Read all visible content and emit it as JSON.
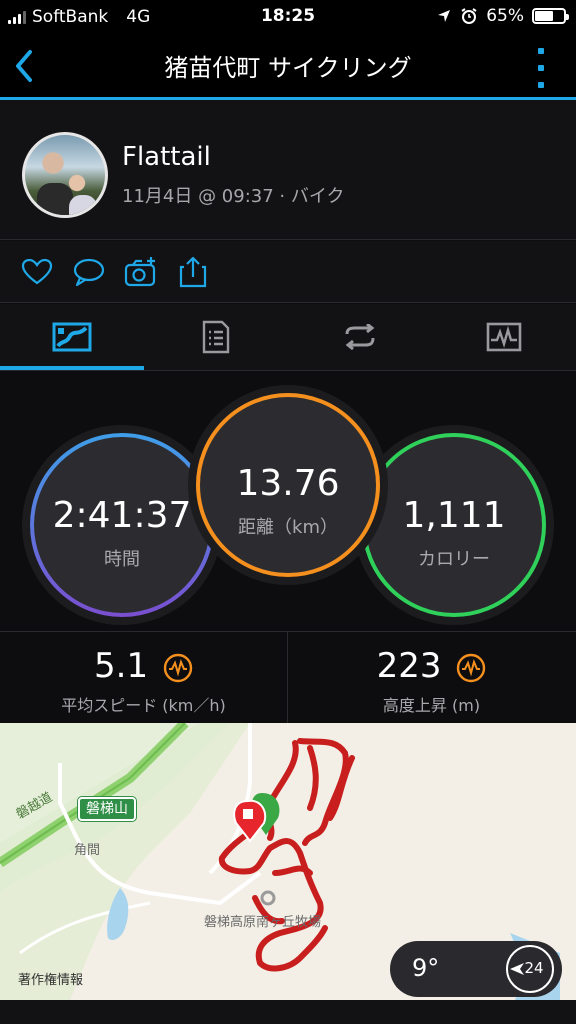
{
  "status_bar": {
    "carrier": "SoftBank",
    "network": "4G",
    "time": "18:25",
    "battery": "65%",
    "battery_level": 0.65
  },
  "header": {
    "title": "猪苗代町 サイクリング"
  },
  "profile": {
    "name": "Flattail",
    "meta": "11月4日 @ 09:37 · バイク"
  },
  "actions": {
    "icons": [
      "heart-icon",
      "comment-icon",
      "add-photo-icon",
      "share-icon"
    ]
  },
  "tabs": {
    "icons": [
      "map-tab-icon",
      "details-tab-icon",
      "laps-tab-icon",
      "charts-tab-icon"
    ],
    "selected_index": 0
  },
  "summary": {
    "time": {
      "value": "2:41:37",
      "label": "時間"
    },
    "distance": {
      "value": "13.76",
      "label": "距離（km）"
    },
    "calories": {
      "value": "1,111",
      "label": "カロリー"
    }
  },
  "stats": {
    "avg_speed": {
      "value": "5.1",
      "label": "平均スピード (km／h)"
    },
    "elevation_gain": {
      "value": "223",
      "label": "高度上昇 (m)"
    }
  },
  "map": {
    "labels": {
      "road": "磐越道",
      "sign": "磐梯山",
      "area": "角間",
      "place": "磐梯高原南ヶ丘牧場",
      "credit": "著作権情報"
    },
    "weather": {
      "temp": "9°",
      "wind": "24"
    }
  },
  "colors": {
    "accent": "#1fa8e8",
    "time_ring": "#5b6fe0",
    "distance_ring": "#f5901e",
    "calories_ring": "#2fd15a",
    "route": "#c81e1e"
  }
}
